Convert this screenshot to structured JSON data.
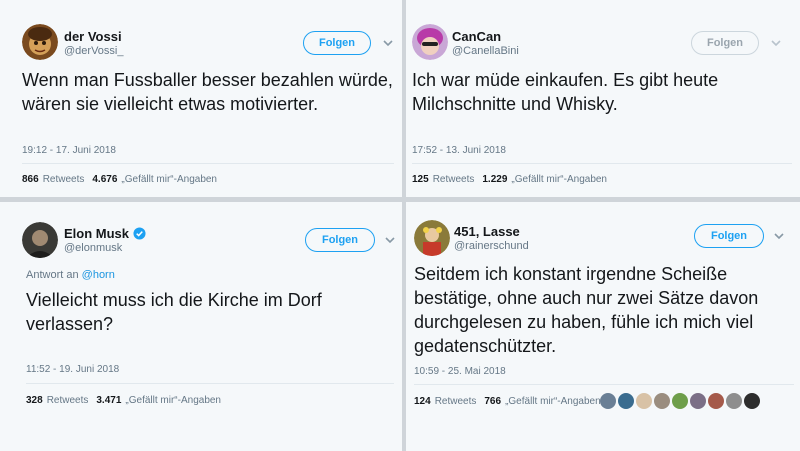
{
  "tweets": [
    {
      "name": "der Vossi",
      "handle": "@derVossi_",
      "follow_label": "Folgen",
      "text_lines": [
        "Wenn man Fussballer besser bezahlen würde,",
        "wären sie vielleicht etwas motivierter."
      ],
      "timestamp": "19:12 - 17. Juni 2018",
      "retweets_count": "866",
      "retweets_label": "Retweets",
      "likes_count": "4.676",
      "likes_label": "„Gefällt mir“-Angaben"
    },
    {
      "name": "CanCan",
      "handle": "@CanellaBini",
      "follow_label": "Folgen",
      "text_lines": [
        "Ich war müde einkaufen. Es gibt heute",
        "Milchschnitte und Whisky."
      ],
      "timestamp": "17:52 - 13. Juni 2018",
      "retweets_count": "125",
      "retweets_label": "Retweets",
      "likes_count": "1.229",
      "likes_label": "„Gefällt mir“-Angaben"
    },
    {
      "name": "Elon Musk",
      "handle": "@elonmusk",
      "follow_label": "Folgen",
      "reply_prefix": "Antwort an",
      "reply_to": "@horn",
      "text_lines": [
        "Vielleicht muss ich die Kirche im Dorf",
        "verlassen?"
      ],
      "timestamp": "11:52 - 19. Juni 2018",
      "retweets_count": "328",
      "retweets_label": "Retweets",
      "likes_count": "3.471",
      "likes_label": "„Gefällt mir“-Angaben"
    },
    {
      "name": "451, Lasse",
      "handle": "@rainerschund",
      "follow_label": "Folgen",
      "text_lines": [
        "Seitdem ich konstant irgendne Scheiße",
        "bestätige, ohne auch nur zwei Sätze davon",
        "durchgelesen zu haben, fühle ich mich viel",
        "gedatenschützter."
      ],
      "timestamp": "10:59 - 25. Mai 2018",
      "retweets_count": "124",
      "retweets_label": "Retweets",
      "likes_count": "766",
      "likes_label": "„Gefällt mir“-Angaben"
    }
  ],
  "colors": {
    "accent": "#1da1f2",
    "link": "#1b95e0",
    "muted_text": "#657786",
    "verified": "#1da1f2",
    "divider": "#cfd4d9"
  },
  "liker_colors": [
    "#6a7f95",
    "#3a6c8f",
    "#d8c2a6",
    "#9a8d7f",
    "#6e9e4a",
    "#7b6f86",
    "#a55a4a",
    "#8e8e8e",
    "#2d2d2d"
  ]
}
